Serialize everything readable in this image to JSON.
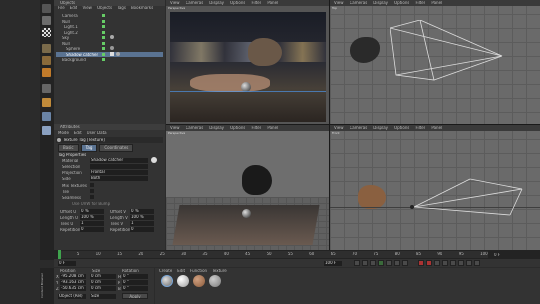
{
  "objects_panel": {
    "title": "Objects",
    "menu": [
      "File",
      "Edit",
      "View",
      "Objects",
      "Tags",
      "Bookmarks"
    ],
    "tree": [
      "Camera",
      "Null",
      "Light.1",
      "Light.2",
      "Sky",
      "Null",
      "Sphere",
      "Shadow catcher",
      "Background"
    ]
  },
  "attributes_panel": {
    "title": "Attributes",
    "menu": [
      "Mode",
      "Edit",
      "User Data"
    ],
    "selected": "Texture Tag [Texture]",
    "tabs": [
      "Basic",
      "Tag",
      "Coordinates"
    ],
    "section": "Tag Properties",
    "material_label": "Material",
    "material_value": "Shadow catcher",
    "selection_label": "Selection",
    "projection_label": "Projection",
    "projection_value": "Frontal",
    "side_label": "Side",
    "side_value": "Both",
    "mix_label": "Mix Textures",
    "tile_label": "Tile",
    "seamless_label": "Seamless",
    "uvw_label": "Use UVW for Bump",
    "offset_u_label": "Offset U",
    "offset_u_value": "0 %",
    "offset_v_label": "Offset V",
    "offset_v_value": "0 %",
    "length_u_label": "Length U",
    "length_u_value": "100 %",
    "length_v_label": "Length V",
    "length_v_value": "100 %",
    "tiles_u_label": "Tiles U",
    "tiles_u_value": "1",
    "tiles_v_label": "Tiles V",
    "tiles_v_value": "1",
    "rep_u_label": "Repetitions U",
    "rep_u_value": "0",
    "rep_v_label": "Repetitions V",
    "rep_v_value": "0"
  },
  "viewport_menu": [
    "View",
    "Cameras",
    "Display",
    "Options",
    "Filter",
    "Panel"
  ],
  "viewports": [
    {
      "label": "Perspective"
    },
    {
      "label": "Top"
    },
    {
      "label": "Perspective"
    },
    {
      "label": "Front"
    }
  ],
  "timeline": {
    "ticks": [
      "0",
      "5",
      "10",
      "15",
      "20",
      "25",
      "30",
      "35",
      "40",
      "45",
      "50",
      "55",
      "60",
      "65",
      "70",
      "75",
      "80",
      "85",
      "90",
      "95",
      "100"
    ],
    "current_frame": "0 F",
    "start_frame": "0 F",
    "end_frame": "100 F",
    "playhead_fraction": 0.0
  },
  "coordinates": {
    "headers": [
      "Position",
      "Size",
      "Rotation"
    ],
    "rows": [
      {
        "axis": "X",
        "pos": "-95.208 cm",
        "size": "0 cm",
        "rot_axis": "H",
        "rot": "0 °"
      },
      {
        "axis": "Y",
        "pos": "-93.163 cm",
        "size": "0 cm",
        "rot_axis": "P",
        "rot": "0 °"
      },
      {
        "axis": "Z",
        "pos": "-50.635 cm",
        "size": "0 cm",
        "rot_axis": "B",
        "rot": "0 °"
      }
    ],
    "mode": "Object (Rel)",
    "size_mode": "Size",
    "apply": "Apply"
  },
  "materials": {
    "menu": [
      "Create",
      "Edit",
      "Function",
      "Texture"
    ],
    "swatch_colors": [
      "#6b6b6b",
      "#9a9a9a",
      "#8a5a3a",
      "#7a7a7a"
    ]
  },
  "side_tab": "Content Browser",
  "colors": {
    "accent": "#7aa6d6",
    "selection": "#5a7392",
    "playhead": "#3fa34d"
  }
}
